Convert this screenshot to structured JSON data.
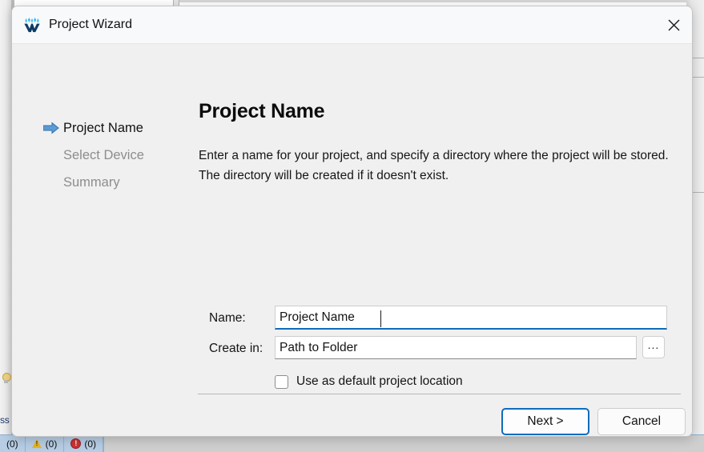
{
  "window": {
    "title": "Project Wizard",
    "app_icon": "wizard-w-logo-icon",
    "close_icon": "close-icon"
  },
  "steps": [
    {
      "label": "Project Name",
      "state": "active",
      "arrow_icon": "arrow-right-icon"
    },
    {
      "label": "Select Device",
      "state": "inactive"
    },
    {
      "label": "Summary",
      "state": "inactive"
    }
  ],
  "pane": {
    "title": "Project Name",
    "description": "Enter a name for your project, and specify a directory where the project will be stored. The directory will be created if it doesn't exist."
  },
  "form": {
    "name_label": "Name:",
    "name_value": "Project Name",
    "name_placeholder": "Project Name",
    "path_label": "Create in:",
    "path_value": "Path to Folder",
    "path_placeholder": "Path to Folder",
    "browse_label": "...",
    "browse_icon": "ellipsis-icon",
    "checkbox_label": "Use as default project location",
    "checkbox_checked": false
  },
  "footer": {
    "next_label": "Next >",
    "cancel_label": "Cancel"
  },
  "statusbar": {
    "cells": [
      {
        "text": "(0)",
        "icon": "none"
      },
      {
        "text": "(0)",
        "icon": "warning-icon"
      },
      {
        "text": "(0)",
        "icon": "error-icon"
      }
    ]
  },
  "background": {
    "left_text": "ss",
    "bulb_icon": "lightbulb-icon"
  },
  "colors": {
    "accent": "#0f6cbd",
    "dialog_bg": "#f0f0f0",
    "titlebar_bg": "#f7f9fb",
    "statusbar_bg": "#b6cde4",
    "warning": "#e8b322",
    "error": "#cc3333"
  }
}
